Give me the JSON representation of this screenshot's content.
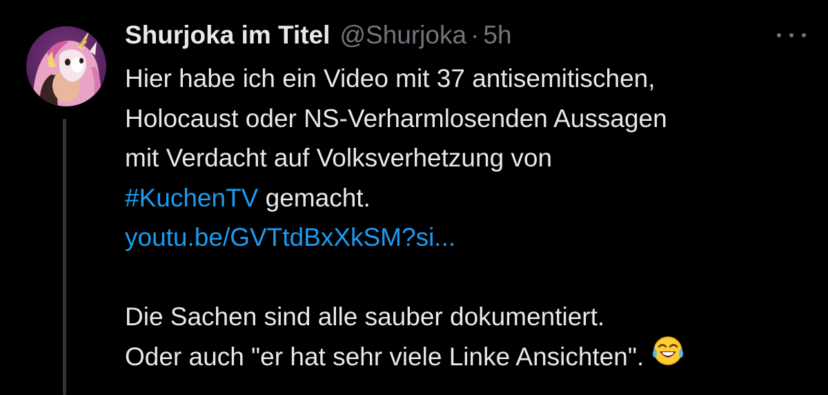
{
  "tweet": {
    "display_name": "Shurjoka im Titel",
    "handle": "@Shurjoka",
    "separator": "·",
    "time": "5h",
    "text_lines": [
      "Hier habe ich ein Video mit 37 antisemitischen,",
      "Holocaust oder NS-Verharmlosenden Aussagen",
      "mit Verdacht auf Volksverhetzung von"
    ],
    "hashtag": "#KuchenTV",
    "after_hashtag": " gemacht.",
    "link": "youtu.be/GVTtdBxXkSM?si...",
    "text_lines_2": [
      "Die Sachen sind alle sauber dokumentiert.",
      "Oder auch \"er hat sehr viele Linke Ansichten\"."
    ],
    "emoji": "face-with-tears-of-joy-icon"
  },
  "icons": {
    "more": "more-horizontal-icon",
    "avatar": "unicorn-costume-avatar"
  },
  "colors": {
    "background": "#000000",
    "text": "#e7e9ea",
    "secondary_text": "#71767b",
    "link": "#1d9bf0",
    "thread_line": "#333639"
  }
}
